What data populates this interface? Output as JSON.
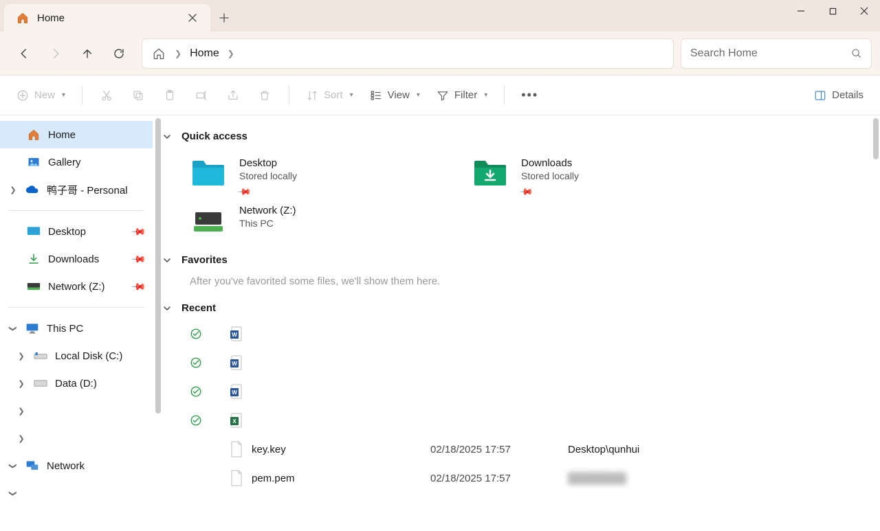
{
  "tab": {
    "title": "Home"
  },
  "address": {
    "current": "Home"
  },
  "search": {
    "placeholder": "Search Home"
  },
  "toolbar": {
    "new": "New",
    "sort": "Sort",
    "view": "View",
    "filter": "Filter",
    "details": "Details"
  },
  "sidebar": {
    "home": "Home",
    "gallery": "Gallery",
    "onedrive": "鸭子哥 - Personal",
    "pinned": [
      {
        "label": "Desktop"
      },
      {
        "label": "Downloads"
      },
      {
        "label": "Network (Z:)"
      }
    ],
    "thispc": "This PC",
    "drives": [
      {
        "label": "Local Disk (C:)"
      },
      {
        "label": "Data (D:)"
      }
    ],
    "network": "Network"
  },
  "sections": {
    "quick_access": "Quick access",
    "favorites": "Favorites",
    "favorites_empty": "After you've favorited some files, we'll show them here.",
    "recent": "Recent"
  },
  "quick_access": [
    {
      "title": "Desktop",
      "sub": "Stored locally",
      "icon": "folder-blue",
      "pinned": true
    },
    {
      "title": "Downloads",
      "sub": "Stored locally",
      "icon": "folder-green-arrow",
      "pinned": true
    },
    {
      "title": "Network (Z:)",
      "sub": "This PC",
      "icon": "drive-network",
      "pinned": false
    }
  ],
  "recent": [
    {
      "name": "",
      "date": "",
      "location": "",
      "type": "word",
      "synced": true
    },
    {
      "name": "",
      "date": "",
      "location": "",
      "type": "word",
      "synced": true
    },
    {
      "name": "",
      "date": "",
      "location": "",
      "type": "word",
      "synced": true
    },
    {
      "name": "",
      "date": "",
      "location": "",
      "type": "excel",
      "synced": true
    },
    {
      "name": "key.key",
      "date": "02/18/2025 17:57",
      "location": "Desktop\\qunhui",
      "type": "file",
      "synced": false
    },
    {
      "name": "pem.pem",
      "date": "02/18/2025 17:57",
      "location": "",
      "type": "file",
      "synced": false,
      "loc_blur": true
    }
  ]
}
